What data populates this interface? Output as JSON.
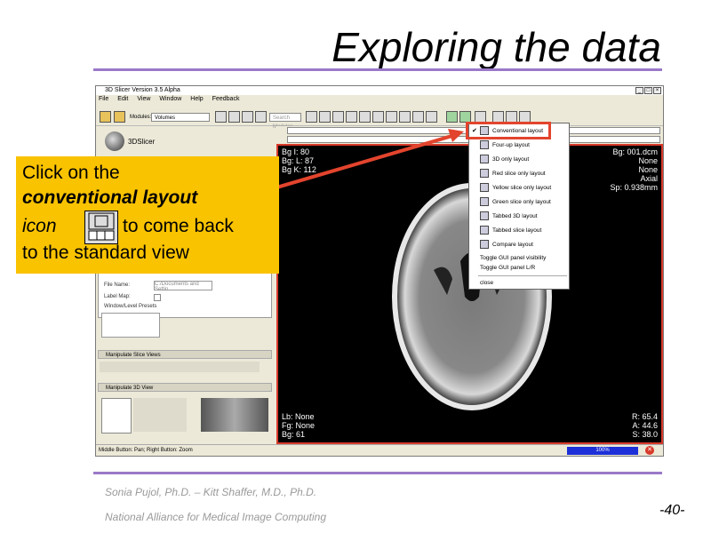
{
  "slide": {
    "title": "Exploring the data",
    "footer_authors": "Sonia Pujol, Ph.D. – Kitt Shaffer, M.D., Ph.D.",
    "footer_org": "National Alliance for Medical Image Computing",
    "page_number": "-40-"
  },
  "window": {
    "title": "3D Slicer Version 3.5 Alpha",
    "menu": [
      "File",
      "Edit",
      "View",
      "Window",
      "Help",
      "Feedback"
    ],
    "module_label": "Modules:",
    "module_value": "Volumes",
    "search_placeholder": "Search Modules"
  },
  "left_panel": {
    "logo_text": "3DSlicer",
    "file_name_label": "File Name:",
    "file_name_value": "C:/Documents and Settin",
    "label_map_label": "Label Map:",
    "window_level_label": "Window/Level Presets",
    "manipulate_slice_views": "Manipulate Slice Views",
    "manipulate_3d_view": "Manipulate 3D View"
  },
  "viewer": {
    "orientation": "Axial",
    "none_select": "None",
    "top_left": [
      "Bg I: 80",
      "Bg: L: 87",
      "Bg K: 112"
    ],
    "top_right": [
      "Bg: 001.dcm",
      "None",
      "None",
      "Axial",
      "Sp: 0.938mm"
    ],
    "bottom_left": [
      "Lb: None",
      "Fg: None",
      "Bg: 61"
    ],
    "bottom_right": [
      "R: 65.4",
      "A: 44.6",
      "S: 38.0"
    ]
  },
  "status": {
    "hint": "Middle Button: Pan; Right Button: Zoom",
    "progress": "100%"
  },
  "layout_menu": {
    "items": [
      "Conventional layout",
      "Four-up layout",
      "3D only layout",
      "Red slice only layout",
      "Yellow slice only layout",
      "Green slice only layout",
      "Tabbed 3D layout",
      "Tabbed slice layout",
      "Compare layout"
    ],
    "toggle_gui": "Toggle GUI panel visibility",
    "toggle_lr": "Toggle GUI panel L/R",
    "close": "close"
  },
  "callout": {
    "line1": "Click on the",
    "line2": "conventional layout",
    "line3a": "icon",
    "line3b": "to come back",
    "line4": "to the standard view"
  },
  "colors": {
    "callout_bg": "#fac300",
    "highlight": "#e3442d",
    "rule": "#9b79c9"
  }
}
